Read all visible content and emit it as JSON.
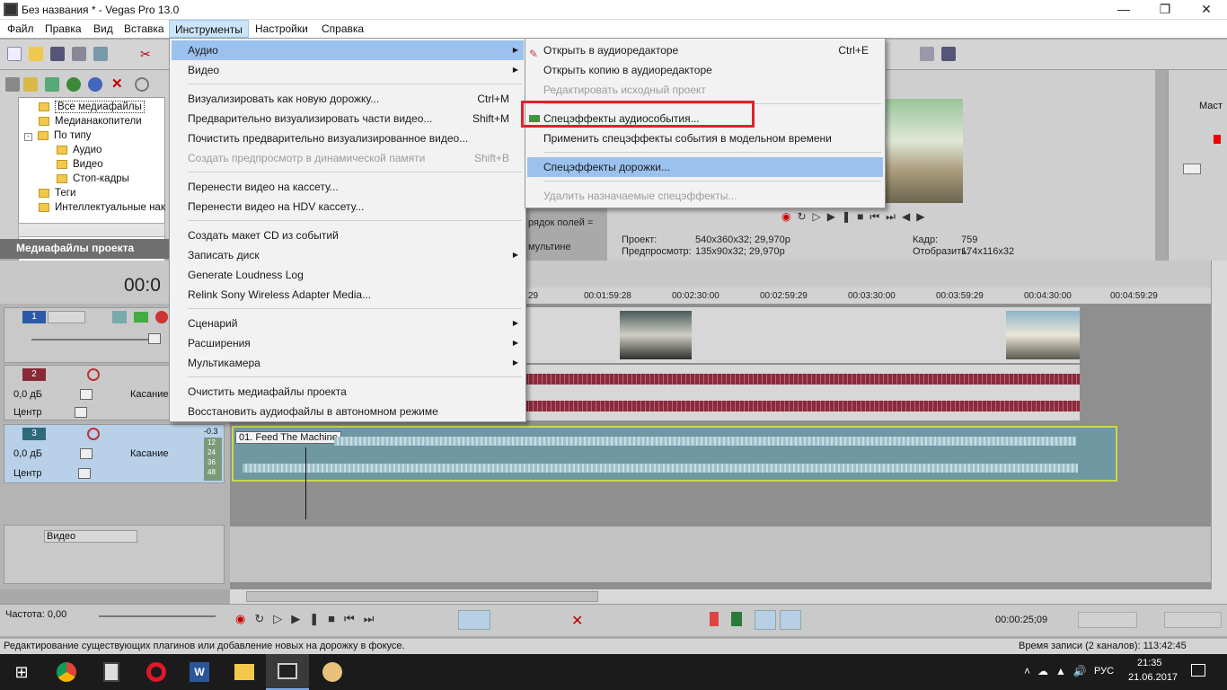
{
  "window": {
    "title": "Без названия * - Vegas Pro 13.0"
  },
  "menubar": {
    "items": [
      "Файл",
      "Правка",
      "Вид",
      "Вставка",
      "Инструменты",
      "Настройки",
      "Справка"
    ]
  },
  "tools_menu": {
    "items": [
      {
        "label": "Аудио",
        "submenu": true,
        "highlighted": true
      },
      {
        "label": "Видео",
        "submenu": true
      },
      {
        "label": "Визуализировать как новую дорожку...",
        "shortcut": "Ctrl+M"
      },
      {
        "label": "Предварительно визуализировать части видео...",
        "shortcut": "Shift+M"
      },
      {
        "label": "Почистить предварительно визуализированное видео..."
      },
      {
        "label": "Создать предпросмотр в динамической памяти",
        "shortcut": "Shift+B",
        "disabled": true
      },
      {
        "label": "Перенести видео на кассету..."
      },
      {
        "label": "Перенести видео на HDV кассету..."
      },
      {
        "label": "Создать макет CD из событий"
      },
      {
        "label": "Записать диск",
        "submenu": true
      },
      {
        "label": "Generate Loudness Log"
      },
      {
        "label": "Relink Sony Wireless Adapter Media..."
      },
      {
        "label": "Сценарий",
        "submenu": true
      },
      {
        "label": "Расширения",
        "submenu": true
      },
      {
        "label": "Мультикамера",
        "submenu": true
      },
      {
        "label": "Очистить медиафайлы проекта"
      },
      {
        "label": "Восстановить аудиофайлы в автономном режиме"
      }
    ]
  },
  "audio_submenu": {
    "items": [
      {
        "label": "Открыть в аудиоредакторе",
        "shortcut": "Ctrl+E"
      },
      {
        "label": "Открыть копию в аудиоредакторе"
      },
      {
        "label": "Редактировать исходный проект",
        "disabled": true
      },
      {
        "label": "Спецэффекты аудиособытия...",
        "boxed": true
      },
      {
        "label": "Применить спецэффекты события в модельном времени"
      },
      {
        "label": "Спецэффекты дорожки...",
        "highlighted": true
      },
      {
        "label": "Удалить назначаемые спецэффекты...",
        "disabled": true
      }
    ]
  },
  "explorer": {
    "tree": [
      "Все медиафайлы",
      "Медианакопители",
      "По типу",
      "Аудио",
      "Видео",
      "Стоп-кадры",
      "Теги",
      "Интеллектуальные нак"
    ],
    "tab_label": "Медиафайлы проекта"
  },
  "preview": {
    "project_label": "Проект:",
    "project_value": "540x360x32; 29,970p",
    "preview_label": "Предпросмотр:",
    "preview_value": "135x90x32; 29,970p",
    "frame_label": "Кадр:",
    "frame_value": "759",
    "display_label": "Отобразить:",
    "display_value": "174x116x32",
    "fields_order": "рядок полей =",
    "multi": "мультине"
  },
  "mixer": {
    "label": "Маст"
  },
  "timeline": {
    "timecode": "00:0",
    "ruler": [
      "29",
      "00:01:59:28",
      "00:02:30:00",
      "00:02:59:29",
      "00:03:30:00",
      "00:03:59:29",
      "00:04:30:00",
      "00:04:59:29"
    ],
    "tracks": [
      {
        "num": "1"
      },
      {
        "num": "2",
        "vol": "0,0 дБ",
        "pan": "Центр",
        "mode": "Касание"
      },
      {
        "num": "3",
        "vol": "0,0 дБ",
        "pan": "Центр",
        "mode": "Касание",
        "meter": "-0.3",
        "meter_ticks": [
          "12",
          "24",
          "36",
          "48"
        ],
        "clip": "01. Feed The Machine"
      },
      {
        "name": "Видео"
      }
    ]
  },
  "transport": {
    "rate_label": "Частота: 0,00",
    "time": "00:00:25;09"
  },
  "status": {
    "left": "Редактирование существующих плагинов или добавление новых на дорожку в фокусе.",
    "right": "Время записи (2 каналов): 113:42:45"
  },
  "taskbar": {
    "lang": "РУС",
    "time": "21:35",
    "date": "21.06.2017"
  },
  "colors": {
    "highlight": "#9bc2ef",
    "box": "#e0232a",
    "wave_red": "#8b2a3c",
    "wave_teal": "#9fc0cb"
  }
}
